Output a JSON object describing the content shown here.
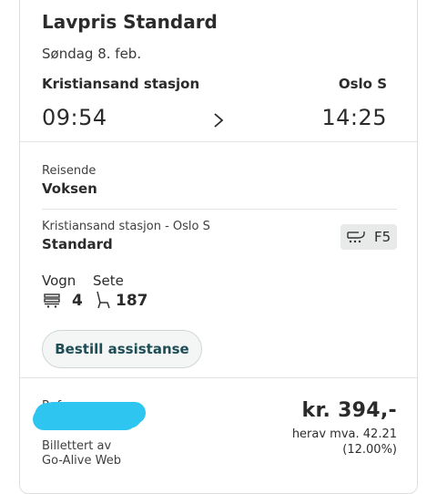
{
  "ticket": {
    "title": "Lavpris Standard",
    "date": "Søndag 8. feb.",
    "from_station": "Kristiansand stasjon",
    "to_station": "Oslo S",
    "departure": "09:54",
    "arrival": "14:25"
  },
  "traveler": {
    "label": "Reisende",
    "value": "Voksen"
  },
  "segment": {
    "route": "Kristiansand stasjon - Oslo S",
    "class": "Standard",
    "badge": "F5"
  },
  "seat": {
    "car_label": "Vogn",
    "seat_label": "Sete",
    "car": "4",
    "seat": "187"
  },
  "assist_button": "Bestill assistanse",
  "reference": {
    "label": "Referanse",
    "issued_label": "Billettert av",
    "issued_by": "Go-Alive Web"
  },
  "price": {
    "amount": "kr. 394,-",
    "vat_line": "herav mva. 42.21",
    "vat_pct": "(12.00%)"
  },
  "colors": {
    "accent_text": "#1e4d55",
    "redaction": "#2ec6f0"
  }
}
